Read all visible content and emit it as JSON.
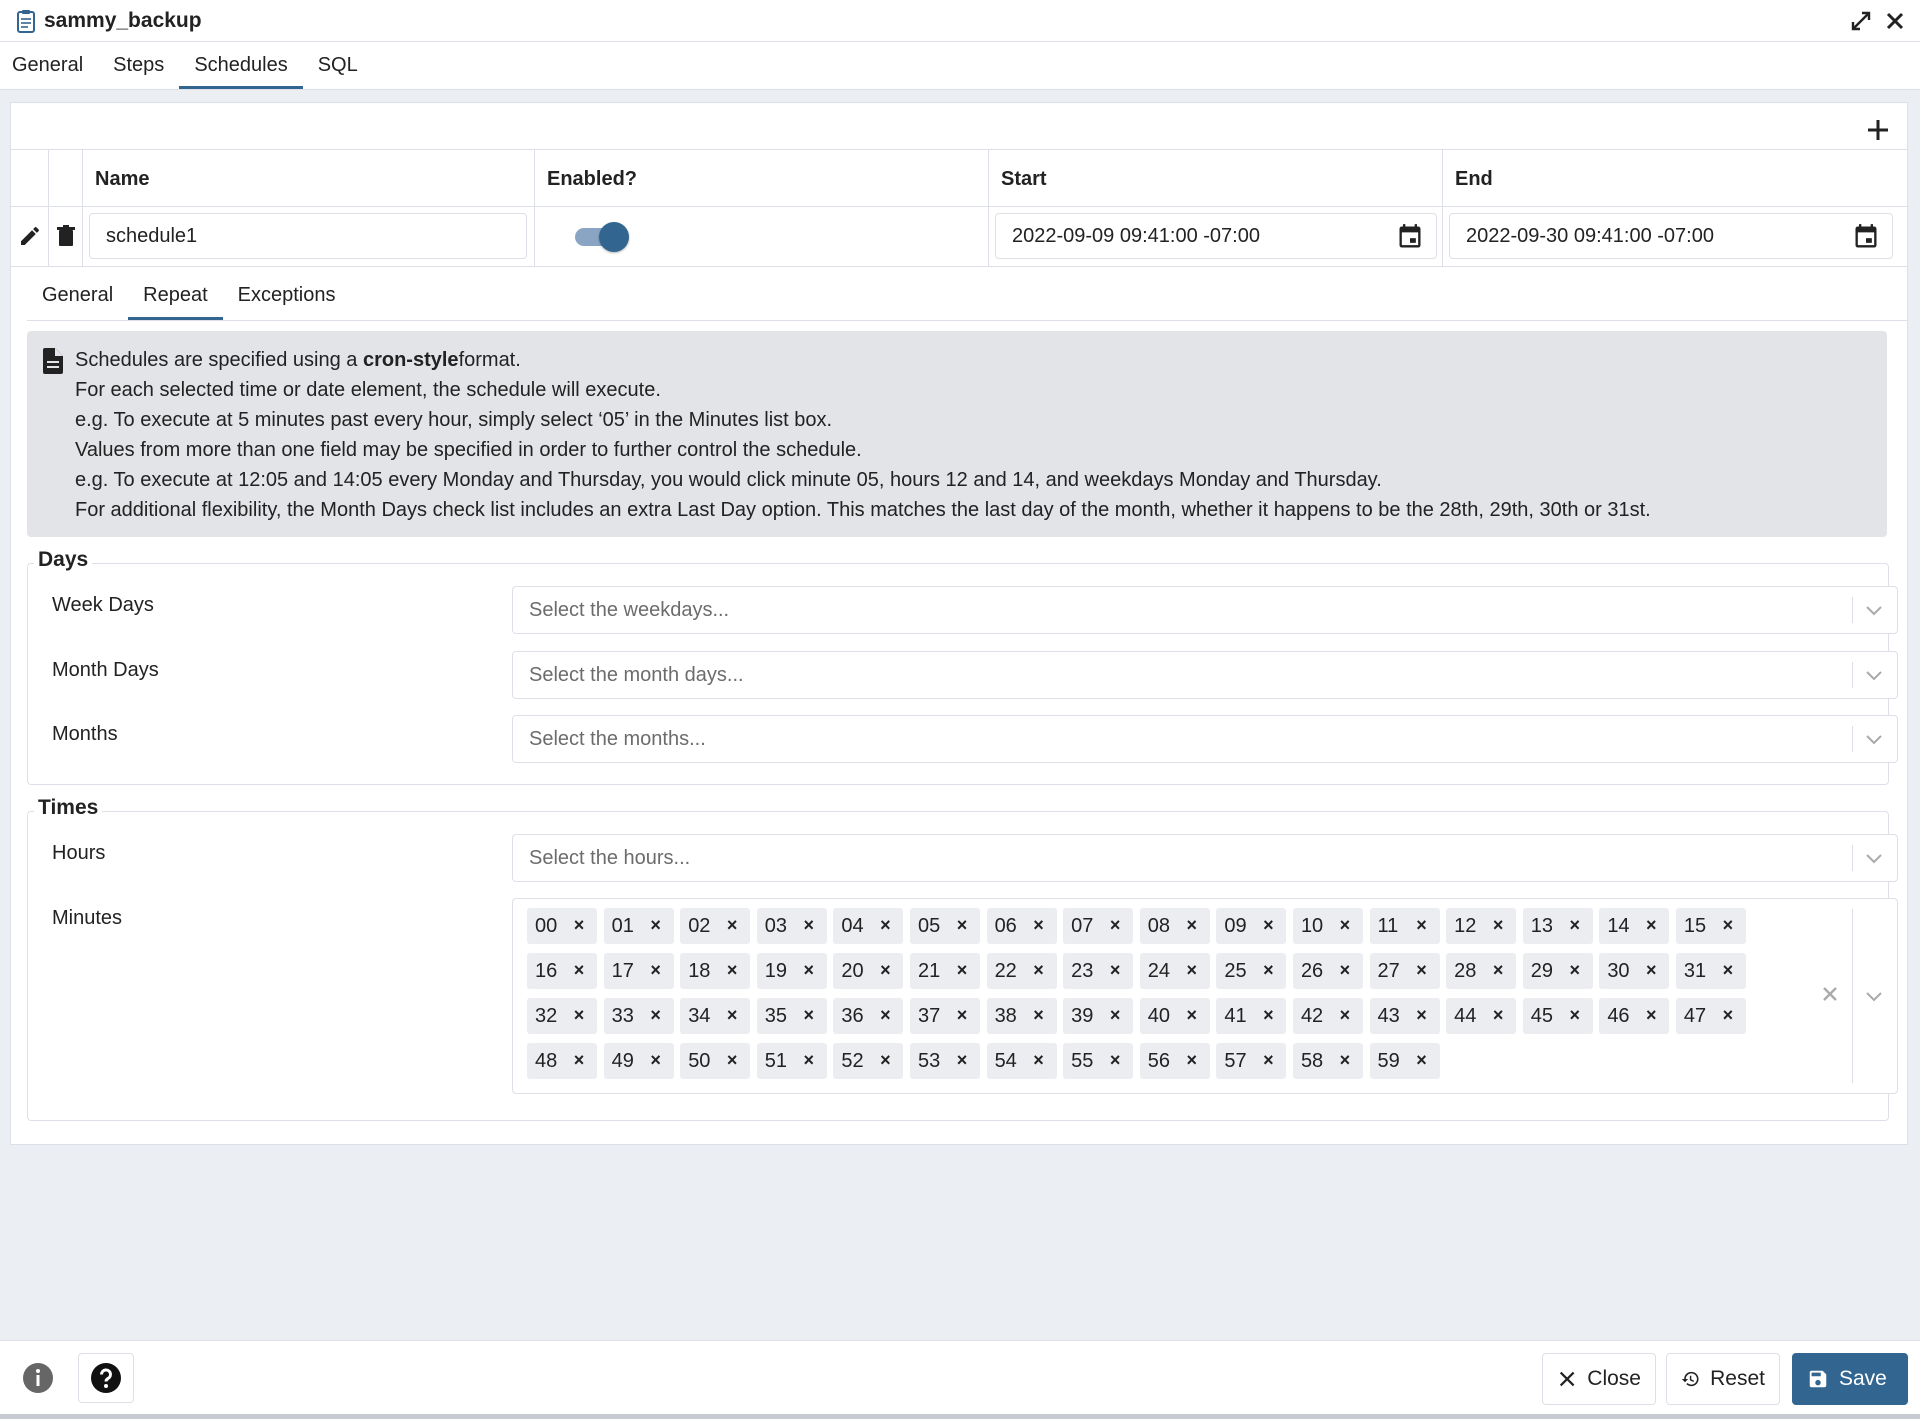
{
  "window": {
    "title": "sammy_backup"
  },
  "top_tabs": [
    {
      "label": "General",
      "active": false
    },
    {
      "label": "Steps",
      "active": false
    },
    {
      "label": "Schedules",
      "active": true
    },
    {
      "label": "SQL",
      "active": false
    }
  ],
  "grid": {
    "headers": {
      "name": "Name",
      "enabled": "Enabled?",
      "start": "Start",
      "end": "End"
    },
    "row": {
      "name": "schedule1",
      "enabled": true,
      "start": "2022-09-09 09:41:00 -07:00",
      "end": "2022-09-30 09:41:00 -07:00"
    }
  },
  "sub_tabs": [
    {
      "label": "General",
      "active": false
    },
    {
      "label": "Repeat",
      "active": true
    },
    {
      "label": "Exceptions",
      "active": false
    }
  ],
  "info": {
    "line1_pre": "Schedules are specified using a ",
    "line1_bold": "cron-style",
    "line1_post": "format.",
    "line2": "For each selected time or date element, the schedule will execute.",
    "line3": "e.g. To execute at 5 minutes past every hour, simply select ‘05’ in the Minutes list box.",
    "line4": "Values from more than one field may be specified in order to further control the schedule.",
    "line5": "e.g. To execute at 12:05 and 14:05 every Monday and Thursday, you would click minute 05, hours 12 and 14, and weekdays Monday and Thursday.",
    "line6": "For additional flexibility, the Month Days check list includes an extra Last Day option. This matches the last day of the month, whether it happens to be the 28th, 29th, 30th or 31st."
  },
  "days": {
    "legend": "Days",
    "week_days": {
      "label": "Week Days",
      "placeholder": "Select the weekdays..."
    },
    "month_days": {
      "label": "Month Days",
      "placeholder": "Select the month days..."
    },
    "months": {
      "label": "Months",
      "placeholder": "Select the months..."
    }
  },
  "times": {
    "legend": "Times",
    "hours": {
      "label": "Hours",
      "placeholder": "Select the hours..."
    },
    "minutes": {
      "label": "Minutes",
      "selected": [
        "00",
        "01",
        "02",
        "03",
        "04",
        "05",
        "06",
        "07",
        "08",
        "09",
        "10",
        "11",
        "12",
        "13",
        "14",
        "15",
        "16",
        "17",
        "18",
        "19",
        "20",
        "21",
        "22",
        "23",
        "24",
        "25",
        "26",
        "27",
        "28",
        "29",
        "30",
        "31",
        "32",
        "33",
        "34",
        "35",
        "36",
        "37",
        "38",
        "39",
        "40",
        "41",
        "42",
        "43",
        "44",
        "45",
        "46",
        "47",
        "48",
        "49",
        "50",
        "51",
        "52",
        "53",
        "54",
        "55",
        "56",
        "57",
        "58",
        "59"
      ]
    }
  },
  "footer": {
    "close_label": "Close",
    "reset_label": "Reset",
    "save_label": "Save"
  },
  "icons": {
    "doc": "clipboard-icon",
    "expand": "expand-icon",
    "close": "close-icon",
    "add": "plus-icon",
    "edit": "pencil-icon",
    "delete": "trash-icon",
    "calendar": "calendar-icon",
    "info_doc": "document-icon",
    "chevron": "chevron-down-icon",
    "info": "info-icon",
    "help": "help-icon",
    "reset": "reset-icon",
    "save": "save-icon"
  },
  "colors": {
    "accent": "#326690",
    "toggle_track": "#8aa5c4",
    "info_bg": "#e2e4e8",
    "chip_bg": "#ebedf0",
    "page_bg": "#ebeef3"
  }
}
